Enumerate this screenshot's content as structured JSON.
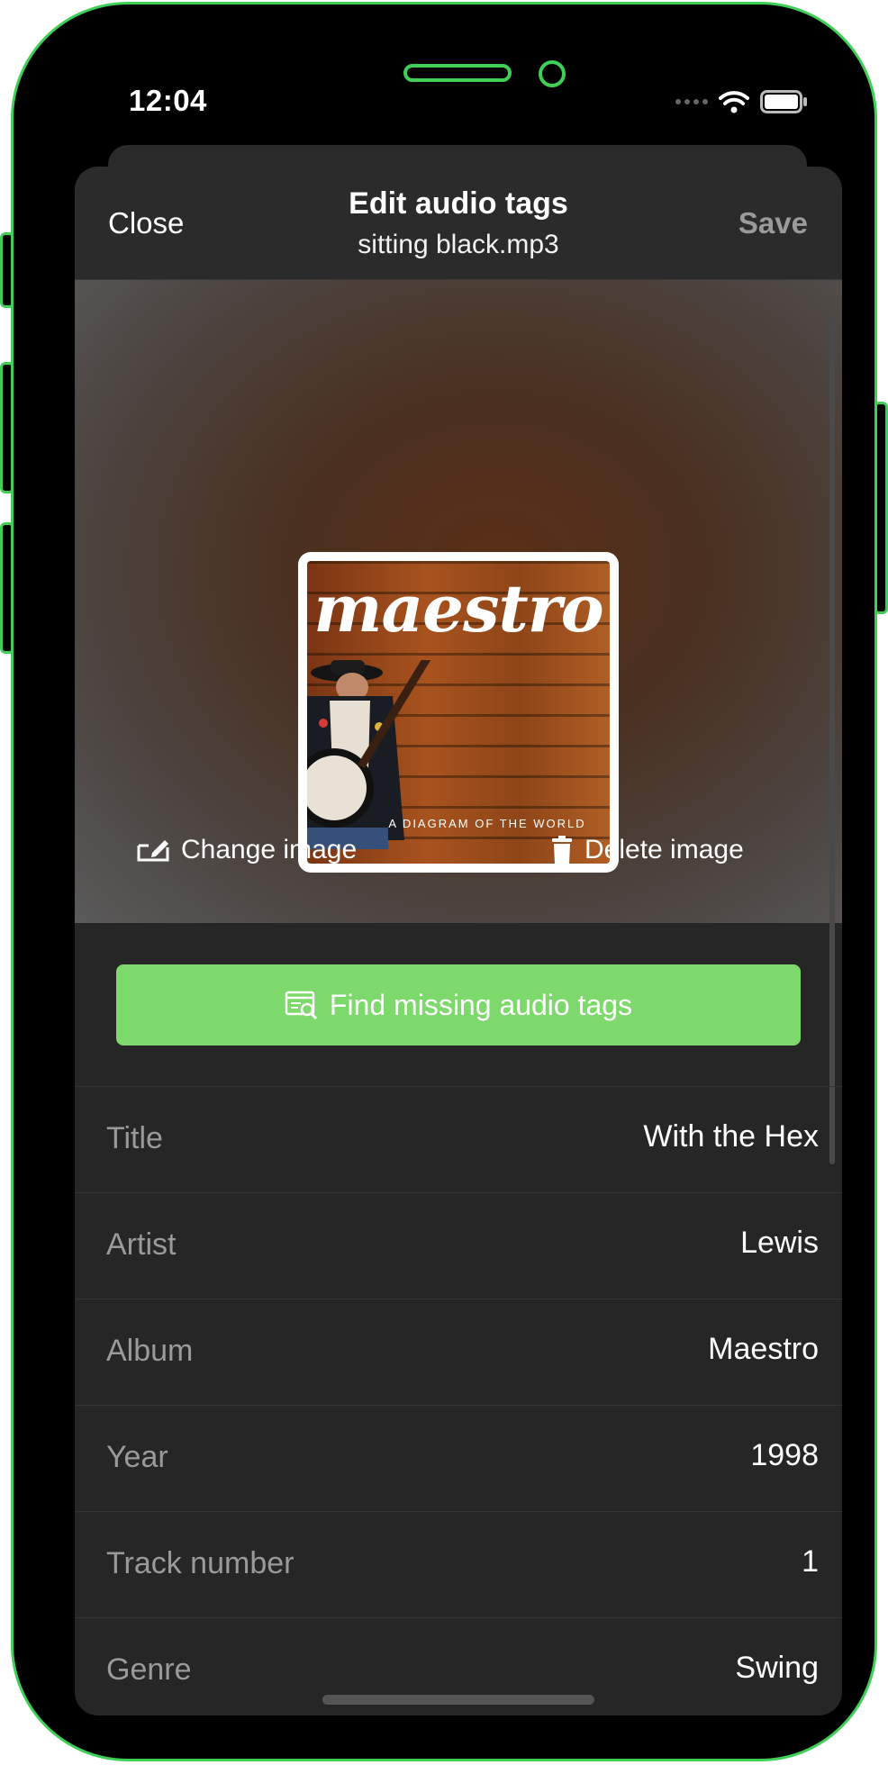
{
  "status_bar": {
    "time": "12:04"
  },
  "nav": {
    "close_label": "Close",
    "title": "Edit audio tags",
    "subtitle": "sitting black.mp3",
    "save_label": "Save"
  },
  "cover": {
    "title": "maestro",
    "subtitle": "A DIAGRAM OF THE WORLD"
  },
  "art_actions": {
    "change_label": "Change image",
    "delete_label": "Delete image"
  },
  "find_button": {
    "label": "Find missing audio tags"
  },
  "fields": [
    {
      "label": "Title",
      "value": "With the Hex"
    },
    {
      "label": "Artist",
      "value": "Lewis"
    },
    {
      "label": "Album",
      "value": "Maestro"
    },
    {
      "label": "Year",
      "value": "1998"
    },
    {
      "label": "Track number",
      "value": "1"
    },
    {
      "label": "Genre",
      "value": "Swing"
    }
  ],
  "colors": {
    "accent_green": "#7dd96b",
    "frame_green": "#3fcf57",
    "sheet_bg": "#262626"
  },
  "icons": [
    "wifi-icon",
    "battery-icon",
    "edit-image-icon",
    "trash-icon",
    "search-tags-icon"
  ]
}
